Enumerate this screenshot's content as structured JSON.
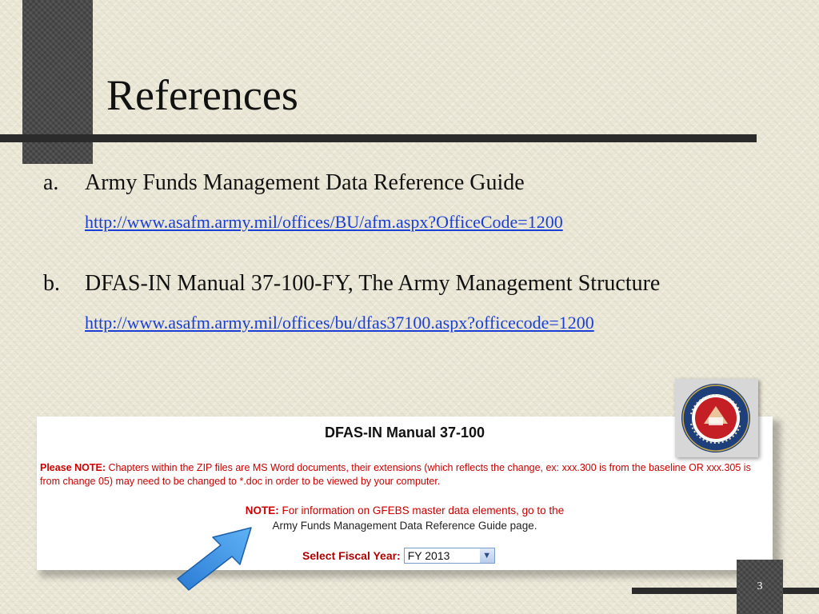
{
  "slide": {
    "title": "References",
    "page_number": "3"
  },
  "references": [
    {
      "letter": "a.",
      "title": "Army Funds Management Data Reference Guide",
      "link": "http://www.asafm.army.mil/offices/BU/afm.aspx?OfficeCode=1200"
    },
    {
      "letter": "b.",
      "title": "DFAS-IN Manual 37-100-FY, The Army Management Structure",
      "link": "http://www.asafm.army.mil/offices/bu/dfas37100.aspx?officecode=1200"
    }
  ],
  "screenshot": {
    "heading": "DFAS-IN Manual 37-100",
    "note1_label": "Please NOTE:",
    "note1_text": " Chapters within the ZIP files are MS Word documents, their extensions (which reflects the change, ex: xxx.300 is from the baseline OR xxx.305 is from change 05) may need to be changed to *.doc in order to be viewed by your computer.",
    "note2_label": "NOTE:",
    "note2_text": " For information on GFEBS master data elements, go to the",
    "note2_link": "Army Funds Management Data Reference Guide",
    "note2_suffix": " page.",
    "fiscal_label": "Select Fiscal Year:",
    "fiscal_value": "FY 2013"
  },
  "colors": {
    "accent_dark": "#2b2b2b",
    "link_blue": "#1a3fd6",
    "note_red": "#cc0000",
    "arrow_blue": "#3a8fe0"
  },
  "icons": {
    "seal": "army-seal-icon",
    "arrow": "blue-pointer-arrow-icon",
    "dropdown": "chevron-down-icon"
  }
}
